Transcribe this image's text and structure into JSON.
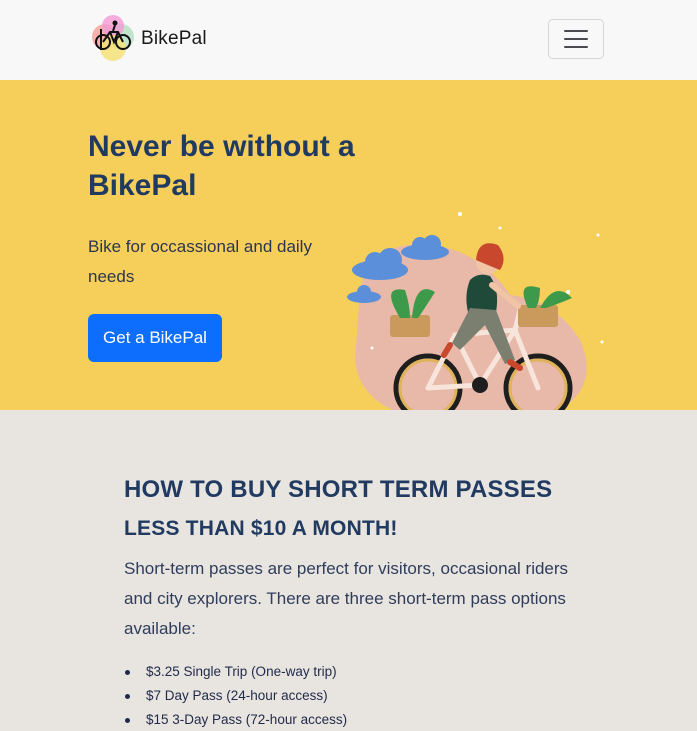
{
  "navbar": {
    "brand": "BikePal",
    "logo_icon": "bike-logo-icon",
    "menu_icon": "hamburger-menu-icon"
  },
  "hero": {
    "title": "Never be without a BikePal",
    "subtitle": "Bike for occassional and daily needs",
    "cta_label": "Get a BikePal",
    "illustration_icon": "woman-riding-bicycle-illustration",
    "colors": {
      "background": "#f5cf5a",
      "button": "#0d6efd",
      "heading": "#213a61"
    }
  },
  "passes": {
    "heading": "HOW TO BUY SHORT TERM PASSES",
    "subheading": "LESS THAN $10 A MONTH!",
    "description": "Short-term passes are perfect for visitors, occasional riders and city explorers. There are three short-term pass options available:",
    "items": [
      "$3.25 Single Trip (One-way trip)",
      "$7 Day Pass (24-hour access)",
      "$15 3-Day Pass (72-hour access)"
    ]
  }
}
